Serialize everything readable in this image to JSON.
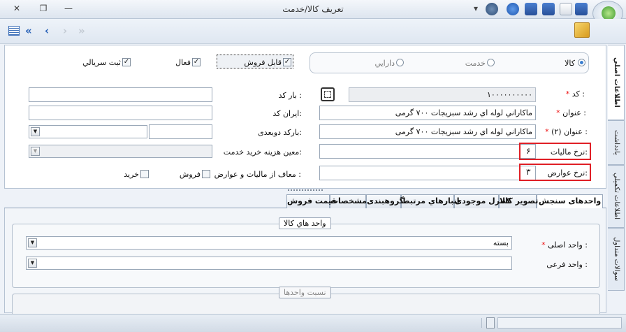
{
  "window": {
    "title": "تعريف کالا/خدمت",
    "close": "✕",
    "maximize": "❐",
    "minimize": "—"
  },
  "quick_access": {
    "dropdown": "▾"
  },
  "toolbar": {
    "first": "«",
    "prev": "‹",
    "next": "›",
    "last": "»",
    "list": "☰"
  },
  "type_options": [
    {
      "label": "کالا",
      "selected": true
    },
    {
      "label": "خدمت",
      "selected": false
    },
    {
      "label": "دارايي",
      "selected": false
    }
  ],
  "flags": {
    "sellable": "قابل فروش",
    "active": "فعال",
    "serial": "ثبت سريالي"
  },
  "fields": {
    "code_label": "کد :",
    "code_value": "۱۰۰۰۰۰۰۰۰۰۰",
    "title_label": "عنوان :",
    "title_value": "ماکاراني لوله اي رشد سبزيجات ۷۰۰ گرمی",
    "title2_label": "عنوان (۲) :",
    "title2_value": "ماکاراني لوله اي رشد سبزيجات ۷۰۰ گرمی",
    "tax_label": "نرخ ماليات:",
    "tax_value": "۶",
    "duty_label": "نرخ عوارض:",
    "duty_value": "۳",
    "barcode_label": "بار کد :",
    "iran_code_label": "ايران کد:",
    "barcode2_label": "بارکد دوبعدی:",
    "service_cost_label": "معين هزينه خريد خدمت:",
    "exempt_label": "معاف از ماليات و عوارض :",
    "sale_label": "فروش",
    "buy_label": "خريد"
  },
  "side_tabs": [
    "اطلاعات اصلي",
    "يادداشت",
    "اطلاعات تکميلي",
    "سوالات متداول"
  ],
  "tabs": [
    "واحدهای سنجش",
    "تصوير کالا",
    "کنترل موجودی",
    "انبارهاي مرتبط",
    "گروهبندی",
    "مشخصات",
    "قيمت فروش"
  ],
  "units": {
    "group_title": "واحد هاي کالا",
    "main_label": "واحد اصلی :",
    "main_value": "بسته",
    "sub_label": "واحد فرعی :",
    "sub_value": "",
    "ratio_title": "نسبت واحدها"
  },
  "colors": {
    "required": "#e11111",
    "highlight": "#e01f26",
    "accent": "#2a63b8"
  }
}
